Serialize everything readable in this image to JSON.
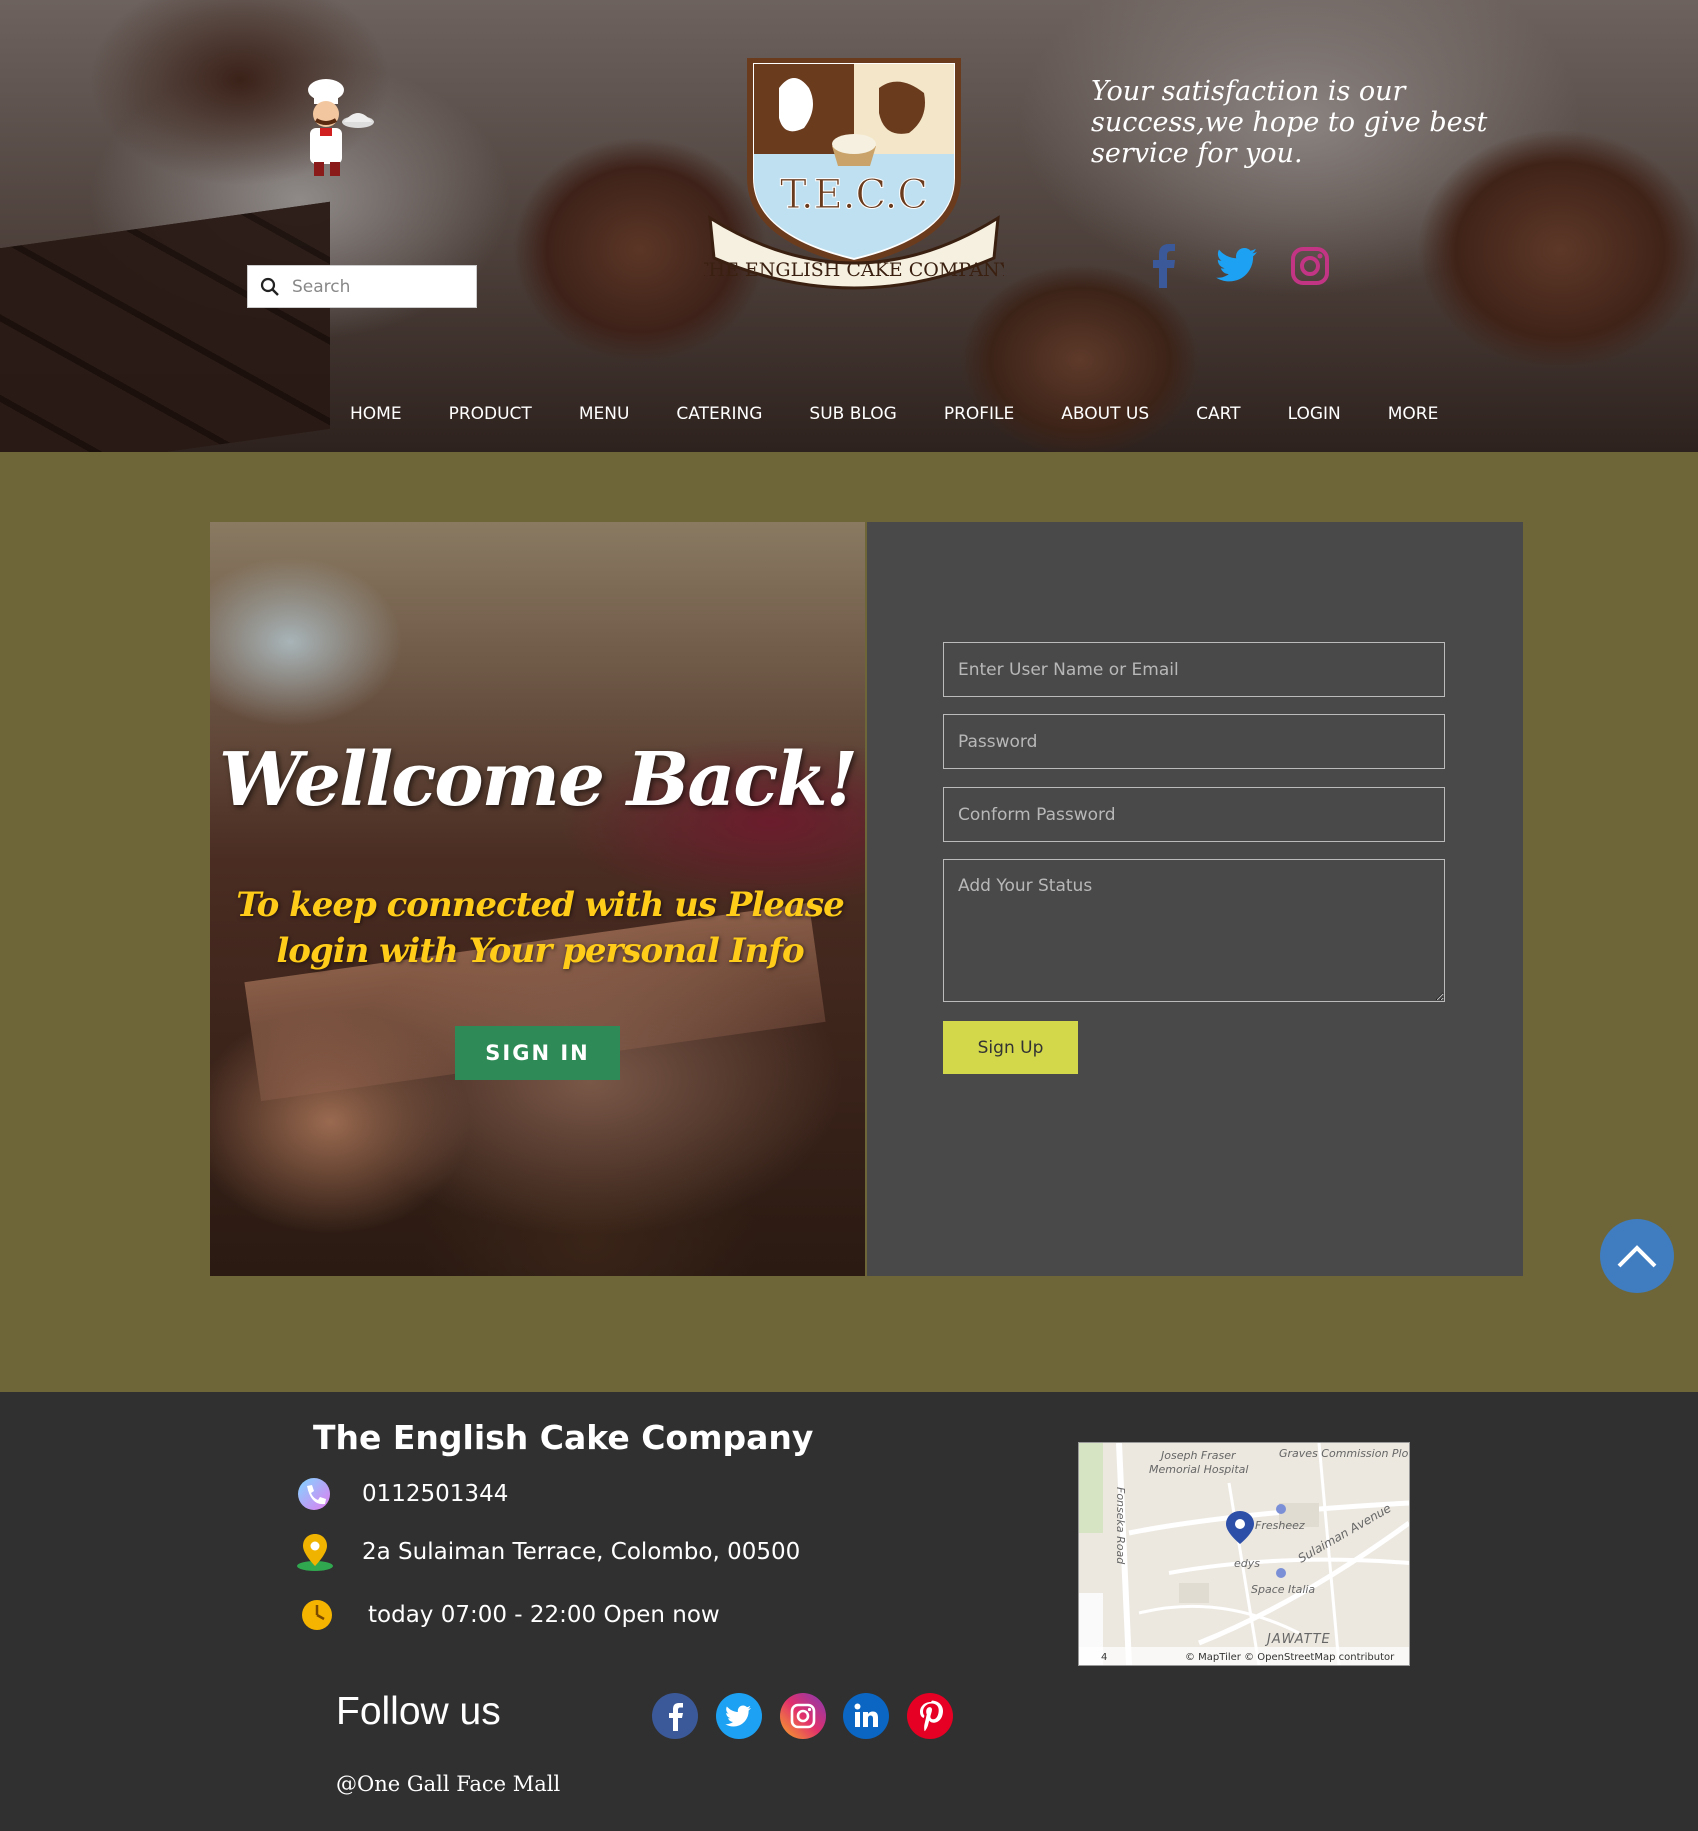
{
  "header": {
    "tagline": "Your satisfaction is our success,we hope to give best service for you.",
    "logo_text": "THE ENGLISH CAKE COMPANY",
    "logo_initials": "T.E.C.C",
    "search": {
      "placeholder": "Search"
    },
    "nav": [
      "HOME",
      "PRODUCT",
      "MENU",
      "CATERING",
      "SUB BLOG",
      "PROFILE",
      "ABOUT US",
      "CART",
      "LOGIN",
      "MORE"
    ]
  },
  "welcome": {
    "title": "Wellcome Back!",
    "subtitle": "To keep connected with us Please login with Your personal Info",
    "signin_label": "SIGN IN"
  },
  "form": {
    "username_placeholder": "Enter User Name or Email",
    "password_placeholder": "Password",
    "confirm_placeholder": "Conform Password",
    "status_placeholder": "Add Your Status",
    "signup_label": "Sign Up"
  },
  "footer": {
    "company": "The English Cake Company",
    "phone": "0112501344",
    "address": "2a Sulaiman Terrace, Colombo, 00500",
    "hours": "today 07:00 - 22:00 Open now",
    "follow_label": "Follow us",
    "location": "@One Gall Face Mall",
    "map": {
      "labels": [
        "Joseph Fraser Memorial Hospital",
        "Graves Commission Plot",
        "Fonseka Road",
        "Fresheez",
        "Sulaiman Avenue",
        "edys",
        "Space Italia",
        "JAWATTE"
      ],
      "attribution": "© MapTiler © OpenStreetMap contributor",
      "corner": "4"
    }
  },
  "colors": {
    "main_bg": "#6e6639",
    "panel_bg": "#494949",
    "footer_bg": "#303030",
    "signin_green": "#2e8b57",
    "signup_yellow": "#d2d84a",
    "subtitle_yellow": "#ffcc1a",
    "scroll_blue": "#3f7dc0"
  },
  "icons": {
    "top_social": [
      "facebook-icon",
      "twitter-icon",
      "instagram-icon"
    ],
    "footer_social": [
      "facebook-icon",
      "twitter-icon",
      "instagram-icon",
      "linkedin-icon",
      "pinterest-icon"
    ]
  }
}
